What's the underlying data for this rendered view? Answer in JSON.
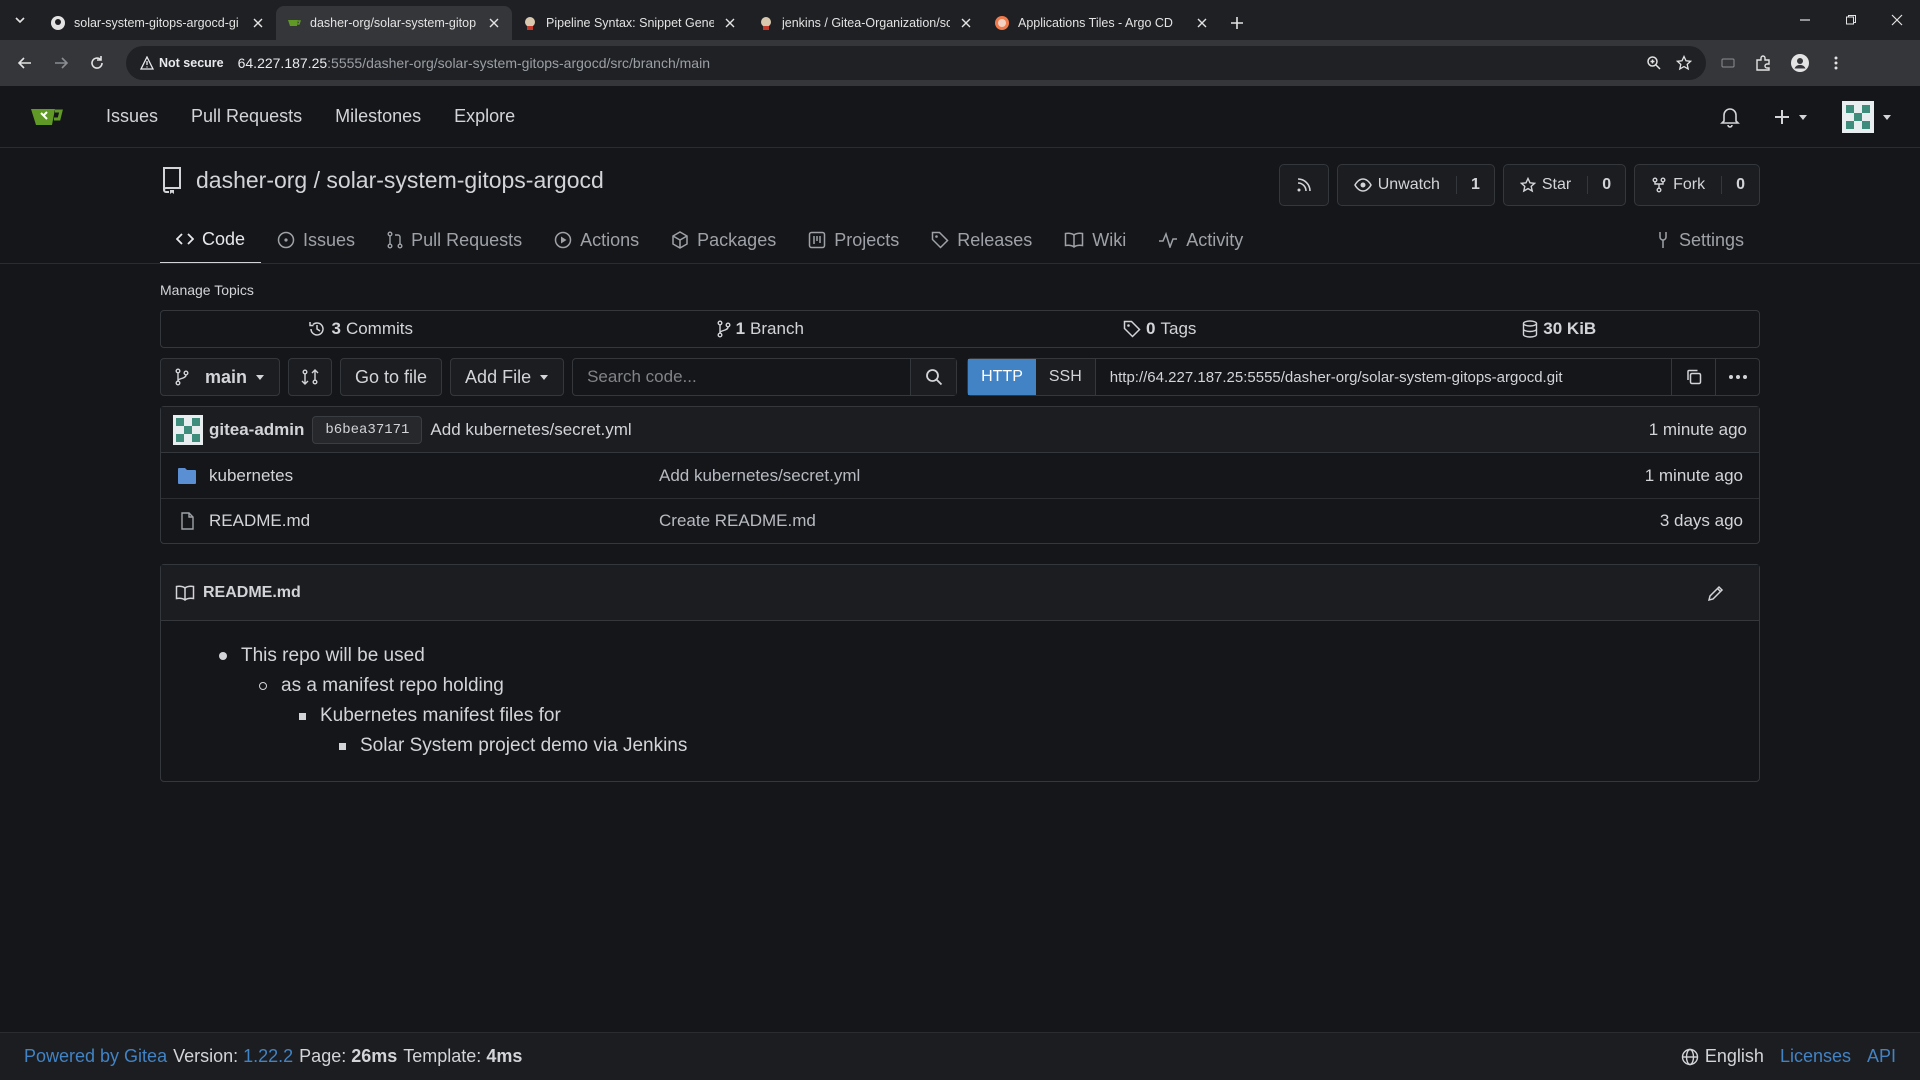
{
  "browser": {
    "tabs": [
      {
        "title": "solar-system-gitops-argocd-gi",
        "icon": "github-icon"
      },
      {
        "title": "dasher-org/solar-system-gitop",
        "icon": "gitea-icon"
      },
      {
        "title": "Pipeline Syntax: Snippet Genera",
        "icon": "jenkins-icon"
      },
      {
        "title": "jenkins / Gitea-Organization/so",
        "icon": "jenkins-icon"
      },
      {
        "title": "Applications Tiles - Argo CD",
        "icon": "argo-icon"
      }
    ],
    "security_label": "Not secure",
    "url_host": "64.227.187.25",
    "url_rest": ":5555/dasher-org/solar-system-gitops-argocd/src/branch/main"
  },
  "nav": {
    "items": [
      "Issues",
      "Pull Requests",
      "Milestones",
      "Explore"
    ]
  },
  "repo": {
    "owner": "dasher-org",
    "separator": "/",
    "name": "solar-system-gitops-argocd",
    "unwatch_label": "Unwatch",
    "watch_count": "1",
    "star_label": "Star",
    "star_count": "0",
    "fork_label": "Fork",
    "fork_count": "0"
  },
  "tabs": {
    "code": "Code",
    "issues": "Issues",
    "pulls": "Pull Requests",
    "actions": "Actions",
    "packages": "Packages",
    "projects": "Projects",
    "releases": "Releases",
    "wiki": "Wiki",
    "activity": "Activity",
    "settings": "Settings"
  },
  "manage_topics": "Manage Topics",
  "stats": {
    "commits_num": "3",
    "commits_label": "Commits",
    "branch_num": "1",
    "branch_label": "Branch",
    "tags_num": "0",
    "tags_label": "Tags",
    "size": "30 KiB"
  },
  "controls": {
    "branch": "main",
    "go_to_file": "Go to file",
    "add_file": "Add File",
    "search_placeholder": "Search code...",
    "http": "HTTP",
    "ssh": "SSH",
    "clone_url": "http://64.227.187.25:5555/dasher-org/solar-system-gitops-argocd.git"
  },
  "latest_commit": {
    "author": "gitea-admin",
    "sha": "b6bea37171",
    "message": "Add kubernetes/secret.yml",
    "time": "1 minute ago"
  },
  "files": [
    {
      "name": "kubernetes",
      "type": "folder",
      "message": "Add kubernetes/secret.yml",
      "time": "1 minute ago"
    },
    {
      "name": "README.md",
      "type": "file",
      "message": "Create README.md",
      "time": "3 days ago"
    }
  ],
  "readme": {
    "title": "README.md",
    "items": [
      "This repo will be used",
      "as a manifest repo holding",
      "Kubernetes manifest files for",
      "Solar System project demo via Jenkins"
    ]
  },
  "footer": {
    "powered": "Powered by Gitea",
    "version_label": "Version:",
    "version": "1.22.2",
    "page_label": "Page:",
    "page_time": "26ms",
    "template_label": "Template:",
    "template_time": "4ms",
    "language": "English",
    "licenses": "Licenses",
    "api": "API"
  },
  "colors": {
    "accent": "#4183c4",
    "background": "#151619",
    "gitea_green": "#609926"
  }
}
